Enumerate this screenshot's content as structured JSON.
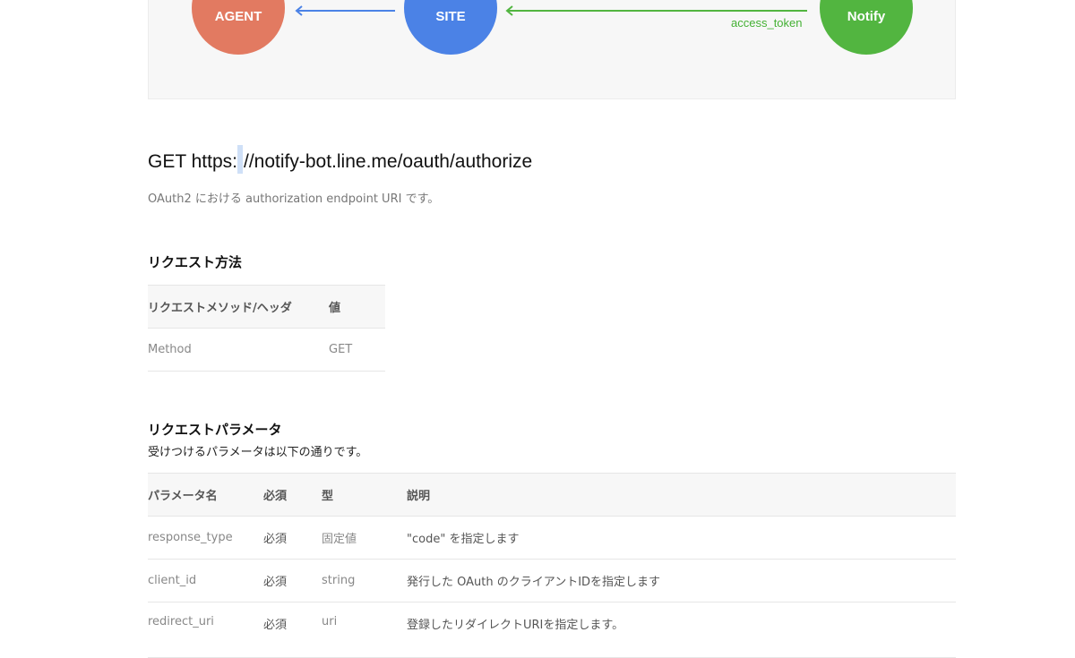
{
  "diagram": {
    "agent_label": "AGENT",
    "site_label": "SITE",
    "notify_label": "Notify",
    "arrow_label": "access_token",
    "colors": {
      "agent": "#e27a61",
      "site": "#4b82e6",
      "notify": "#52b540"
    }
  },
  "endpoint": {
    "title_prefix": "GET https:",
    "title_suffix": "//notify-bot.line.me/oauth/authorize",
    "description": "OAuth2 における authorization endpoint URI です。"
  },
  "request_method": {
    "heading": "リクエスト方法",
    "columns": [
      "リクエストメソッド/ヘッダ",
      "値"
    ],
    "rows": [
      [
        "Method",
        "GET"
      ]
    ]
  },
  "request_params": {
    "heading": "リクエストパラメータ",
    "description": "受けつけるパラメータは以下の通りです。",
    "columns": [
      "パラメータ名",
      "必須",
      "型",
      "説明"
    ],
    "rows": [
      [
        "response_type",
        "必須",
        "固定値",
        "\"code\" を指定します"
      ],
      [
        "client_id",
        "必須",
        "string",
        "発行した OAuth のクライアントIDを指定します"
      ],
      [
        "redirect_uri",
        "必須",
        "uri",
        "登録したリダイレクトURIを指定します。"
      ]
    ]
  }
}
